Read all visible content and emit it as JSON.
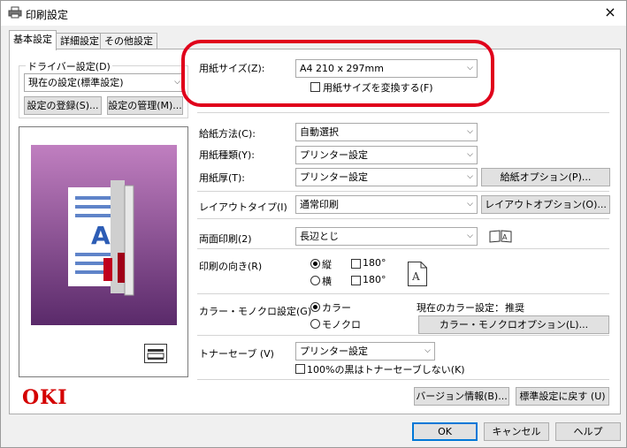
{
  "window": {
    "title": "印刷設定",
    "close": "×"
  },
  "tabs": [
    {
      "label": "基本設定",
      "active": true
    },
    {
      "label": "詳細設定",
      "active": false
    },
    {
      "label": "その他設定",
      "active": false
    }
  ],
  "driver": {
    "group_label": "ドライバー設定(D)",
    "current": "現在の設定(標準設定)",
    "register_button": "設定の登録(S)...",
    "manage_button": "設定の管理(M)..."
  },
  "paper_size": {
    "label": "用紙サイズ(Z):",
    "value": "A4 210 x 297mm",
    "convert_label": "用紙サイズを変換する(F)",
    "convert_checked": false
  },
  "feed": {
    "tray_label": "給紙方法(C):",
    "tray_value": "自動選択",
    "type_label": "用紙種類(Y):",
    "type_value": "プリンター設定",
    "weight_label": "用紙厚(T):",
    "weight_value": "プリンター設定",
    "options_button": "給紙オプション(P)..."
  },
  "layout": {
    "label": "レイアウトタイプ(I)",
    "value": "通常印刷",
    "options_button": "レイアウトオプション(O)..."
  },
  "duplex": {
    "label": "両面印刷(2)",
    "value": "長辺とじ"
  },
  "orientation": {
    "label": "印刷の向き(R)",
    "portrait": "縦",
    "landscape": "横",
    "rotate1": "180°",
    "rotate2": "180°",
    "selected": "portrait"
  },
  "color": {
    "label": "カラー・モノクロ設定(G)",
    "color_option": "カラー",
    "mono_option": "モノクロ",
    "selected": "color",
    "current_label": "現在のカラー設定：",
    "current_value": "推奨",
    "options_button": "カラー・モノクロオプション(L)..."
  },
  "toner": {
    "label": "トナーセーブ (V)",
    "value": "プリンター設定",
    "black_label": "100%の黒はトナーセーブしない(K)",
    "black_checked": false
  },
  "footer": {
    "logo": "OKI",
    "version_button": "バージョン情報(B)...",
    "defaults_button": "標準設定に戻す (U)",
    "ok": "OK",
    "cancel": "キャンセル",
    "help": "ヘルプ"
  },
  "colors": {
    "highlight": "#e0001b",
    "logo": "#d40000",
    "preview_top": "#c07fc0",
    "preview_bottom": "#5a2a6a"
  },
  "icons": [
    "printer-icon",
    "close-icon",
    "chevron-down-icon",
    "booklet-icon",
    "page-orientation-icon",
    "printer-preview-icon"
  ]
}
